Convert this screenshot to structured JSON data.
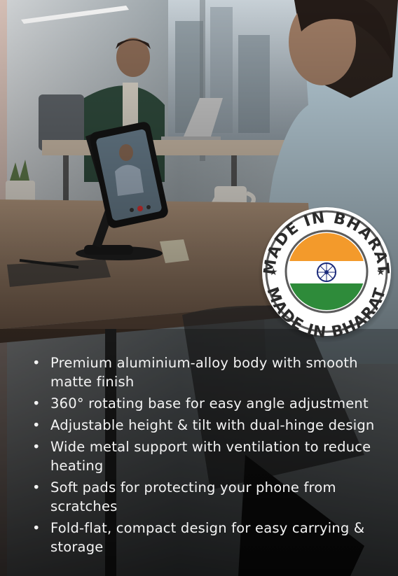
{
  "badge": {
    "top_text": "MADE IN BHARAT",
    "bottom_text": "MADE IN BHARAT",
    "colors": {
      "saffron": "#f39a2b",
      "white": "#ffffff",
      "green": "#2e8b3a",
      "chakra": "#1b2a7a"
    }
  },
  "features": [
    "Premium aluminium-alloy body with smooth matte finish",
    "360° rotating base for easy angle adjustment",
    "Adjustable height & tilt with dual-hinge design",
    "Wide metal support with ventilation to reduce heating",
    "Soft pads for protecting your phone from scratches",
    "Fold-flat, compact design for easy carrying & storage"
  ],
  "bullet_lines": [
    [
      "Premium aluminium-alloy body with smooth",
      "matte finish"
    ],
    [
      "360° rotating base for easy angle adjustment"
    ],
    [
      "Adjustable height & tilt with dual-hinge design"
    ],
    [
      "Wide metal support with ventilation to reduce",
      "heating"
    ],
    [
      "Soft pads for protecting your phone from",
      "scratches"
    ],
    [
      "Fold-flat, compact design for easy carrying &",
      "storage"
    ]
  ]
}
